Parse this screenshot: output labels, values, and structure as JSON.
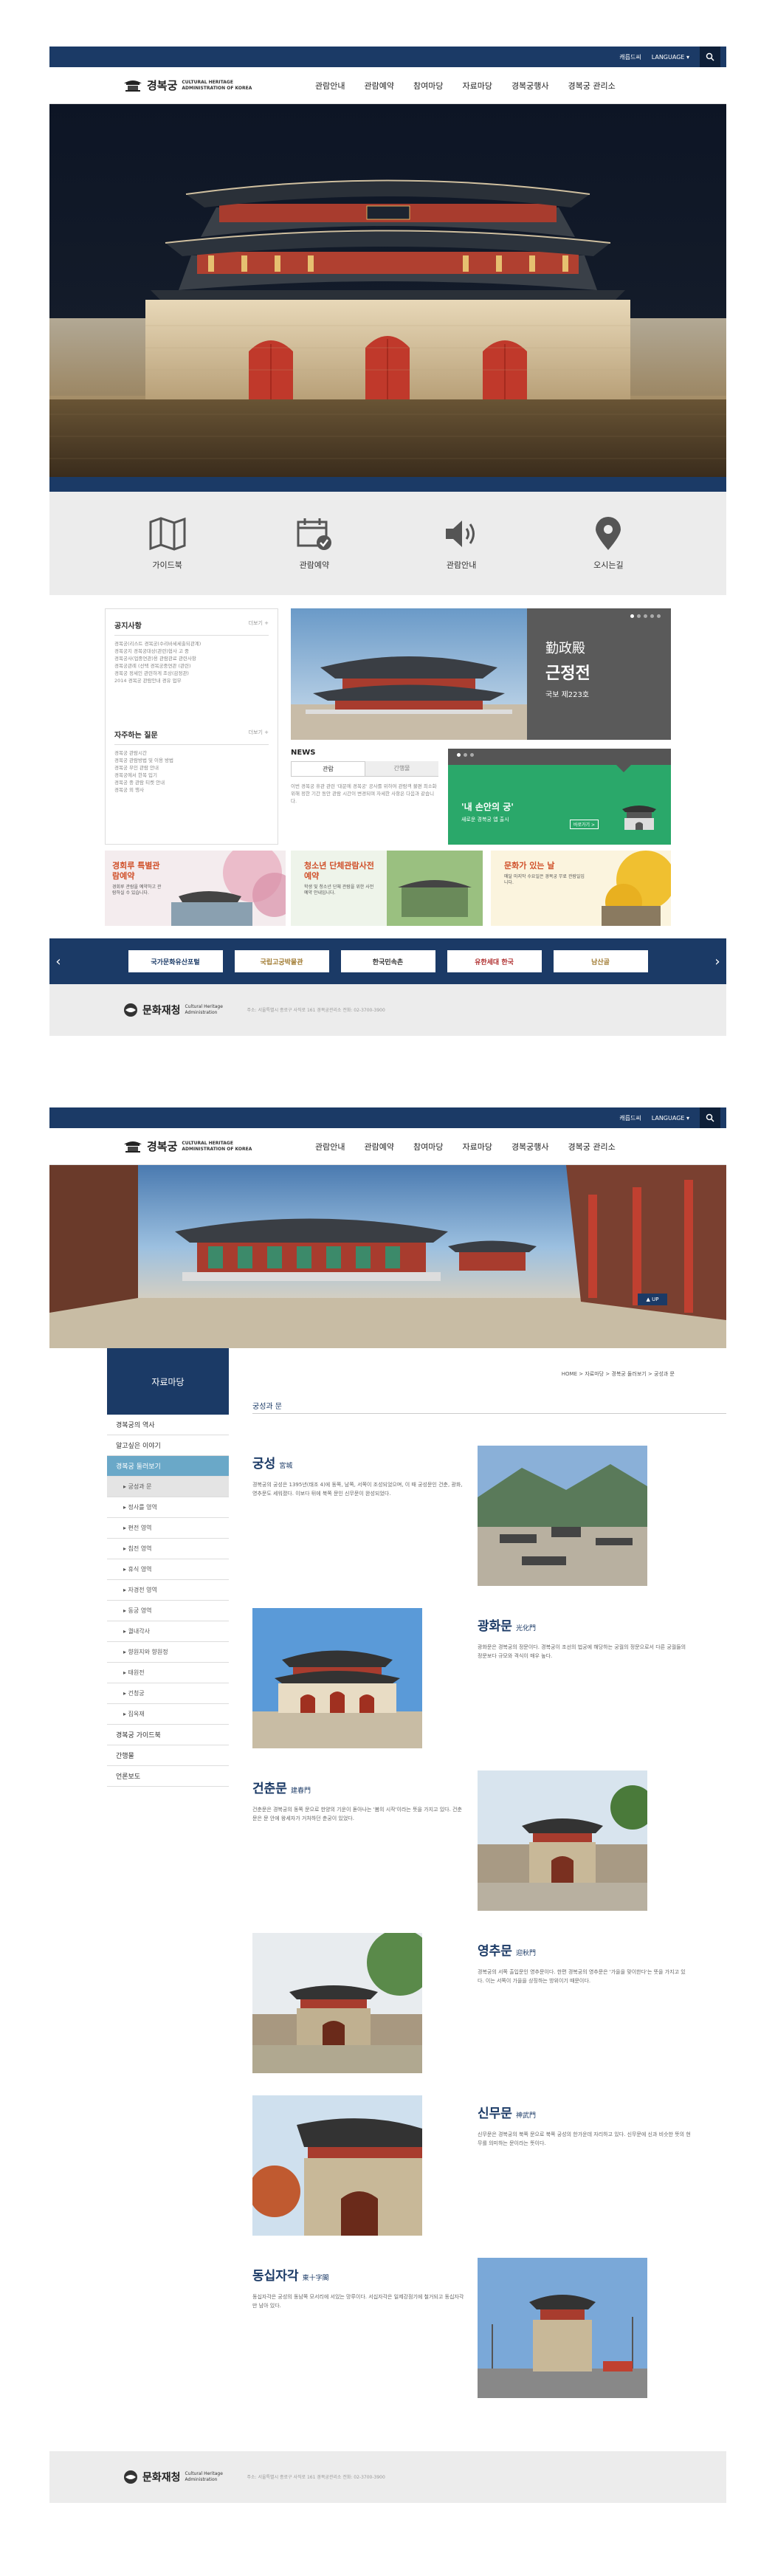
{
  "header": {
    "top_links": [
      "캐릅드씨",
      "LANGUAGE ▾"
    ],
    "logo_ko": "경복궁",
    "logo_en_1": "CULTURAL HERITAGE",
    "logo_en_2": "ADMINISTRATION OF KOREA",
    "menu": [
      "관람안내",
      "관람예약",
      "참여마당",
      "자료마당",
      "경복궁행사",
      "경복궁 관리소"
    ]
  },
  "quick_menu": [
    "가이드북",
    "관람예약",
    "관람안내",
    "오시는길"
  ],
  "notice": {
    "title": "공지사항",
    "more": "더보기 +",
    "items": [
      "경복궁(리스트 경복궁(수리바세세출되관계)",
      "경복궁지 경복궁대상(관련)협사 고 중",
      "경복궁사(업중연관)용 관람관료 관련사항",
      "경복궁관례 (선택 경복궁중연관 (관련)",
      "경복궁 정세인 관련하게 조상(감정관)",
      "2014 경복궁 관람안내 경유 업무"
    ]
  },
  "faq": {
    "title": "자주하는 질문",
    "more": "더보기 +",
    "items": [
      "경복궁 관람시간",
      "경복궁 관람방법 및 이용 방법",
      "경복궁 무인 관람 안내",
      "경복궁에서 한복 입기",
      "경복궁 중 관람 티켓 안내",
      "경복궁 외 행사"
    ]
  },
  "feature": {
    "hanja": "勤政殿",
    "name": "근정전",
    "sub": "국보 제223호"
  },
  "news": {
    "title": "NEWS",
    "tabs": [
      "관람",
      "간행물"
    ],
    "body": "이번 경복궁 휴관 관련 '대문에 경복궁' 공사를 위하여 관람객 불편 최소화 위해 정한 기간 동안 관람 시간이 변경되며 자세한 사항은 다음과 같습니다."
  },
  "promo": {
    "title": "'내 손안의 궁'",
    "desc": "새로운 경복궁 앱 출시",
    "button": "바로가기 >"
  },
  "banners": [
    {
      "title": "경회루 특별관람예약",
      "desc": "경회루 관람을 예약하고 관람하실 수 있습니다."
    },
    {
      "title": "청소년 단체관람사전예약",
      "desc": "학생 및 청소년 단체 관람을 위한 사전 예약 안내입니다."
    },
    {
      "title": "문화가 있는 날",
      "desc": "매달 마지막 수요일은 경복궁 무료 관람일입니다."
    }
  ],
  "family_sites": [
    "국가문화유산포털",
    "국립고궁박물관",
    "한국민속촌",
    "유한세대 한국",
    "남산골"
  ],
  "footer": {
    "logo_ko": "문화재청",
    "logo_en": "Cultural Heritage Administration",
    "text": "주소: 서울특별시 종로구 사직로 161 경복궁관리소 전화: 02-3700-3900"
  },
  "sub_page": {
    "side_title": "자료마당",
    "side_menu": [
      {
        "label": "경복궁의 역사",
        "type": "main"
      },
      {
        "label": "알고싶은 이야기",
        "type": "main"
      },
      {
        "label": "경복궁 둘러보기",
        "type": "active"
      },
      {
        "label": "궁성과 문",
        "type": "sub-on"
      },
      {
        "label": "정사를 영역",
        "type": "sub"
      },
      {
        "label": "편전 영역",
        "type": "sub"
      },
      {
        "label": "침전 영역",
        "type": "sub"
      },
      {
        "label": "휴식 영역",
        "type": "sub"
      },
      {
        "label": "자경전 영역",
        "type": "sub"
      },
      {
        "label": "동궁 영역",
        "type": "sub"
      },
      {
        "label": "궐내각사",
        "type": "sub"
      },
      {
        "label": "향원지와 향원정",
        "type": "sub"
      },
      {
        "label": "태원전",
        "type": "sub"
      },
      {
        "label": "건청궁",
        "type": "sub"
      },
      {
        "label": "집옥재",
        "type": "sub"
      },
      {
        "label": "경복궁 가이드북",
        "type": "main"
      },
      {
        "label": "간행물",
        "type": "main"
      },
      {
        "label": "언론보도",
        "type": "main"
      }
    ],
    "breadcrumb": "HOME > 자료마당 > 경복궁 둘러보기 > 궁성과 문",
    "content_title": "궁성과 문",
    "gates": [
      {
        "name": "궁성",
        "hanja": "宮城",
        "text": "경복궁의 궁성은 1395년(태조 4)에 동쪽, 남쪽, 서쪽이 조성되었으며, 이 때 궁성문인 건춘, 광화, 영추문도 세워졌다. 이보다 뒤에 북쪽 문인 신무문이 완성되었다."
      },
      {
        "name": "광화문",
        "hanja": "光化門",
        "text": "광화문은 경복궁의 정문이다. 경복궁이 조선의 법궁에 해당하는 궁궐의 정문으로서 다른 궁궐들의 정문보다 규모와 격식이 매우 높다."
      },
      {
        "name": "건춘문",
        "hanja": "建春門",
        "text": "건춘문은 경복궁의 동쪽 문으로 한양의 기운이 돋아나는 '봄의 시작'이라는 뜻을 가지고 있다. 건춘문은 문 안에 왕세자가 거처하던 춘궁이 있었다."
      },
      {
        "name": "영추문",
        "hanja": "迎秋門",
        "text": "경복궁의 서쪽 출입문인 영추문이다. 한편 경복궁의 영추문은 '가을을 맞이한다'는 뜻을 가지고 있다. 이는 서쪽이 가을을 상징하는 방위이기 때문이다."
      },
      {
        "name": "신무문",
        "hanja": "神武門",
        "text": "신무문은 경복궁의 북쪽 문으로 북쪽 궁성의 한가운데 자리하고 있다. 신무문에 신과 비슷한 뜻의 현무를 의미하는 문이라는 뜻이다."
      },
      {
        "name": "동십자각",
        "hanja": "東十字閣",
        "text": "동십자각은 궁성의 동남쪽 모서리에 서있는 망루이다. 서십자각은 일제강점기에 철거되고 동십자각만 남아 있다."
      }
    ],
    "up": "▲ UP"
  }
}
